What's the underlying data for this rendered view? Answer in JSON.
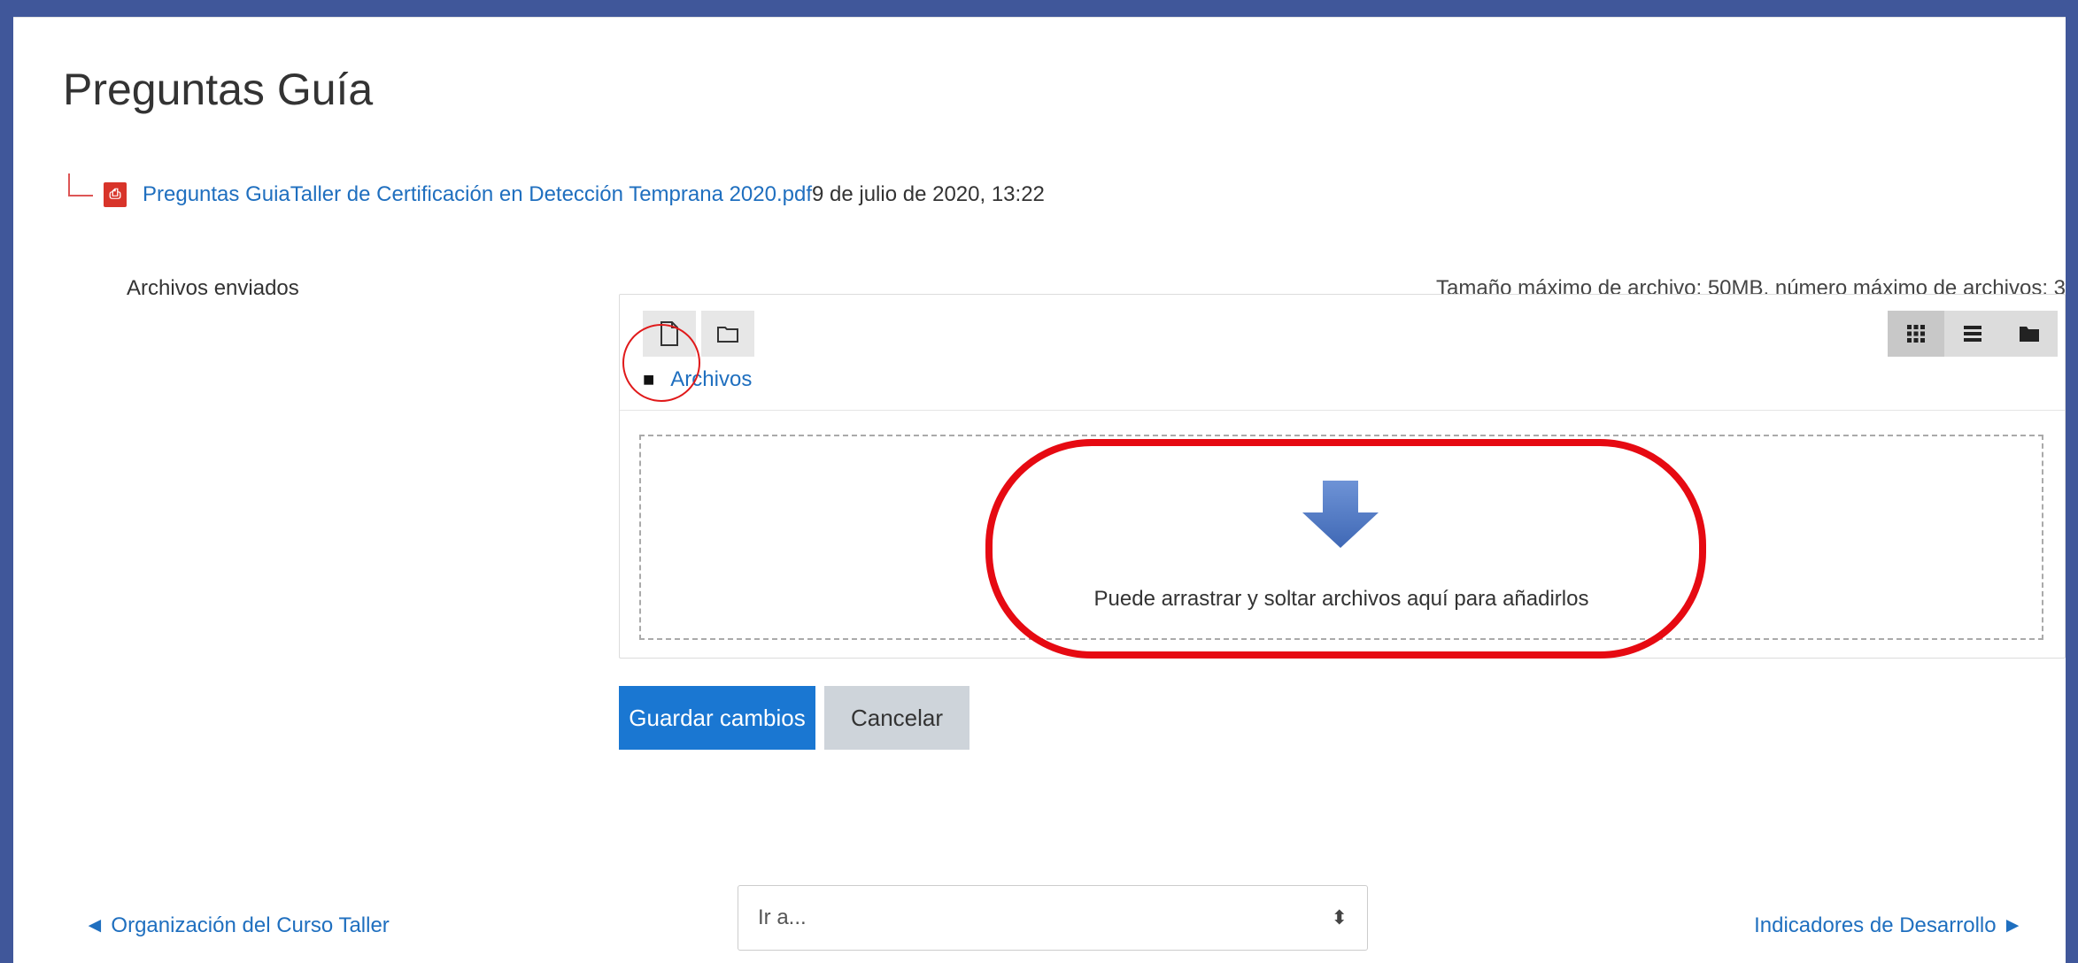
{
  "page": {
    "title": "Preguntas Guía"
  },
  "attachment": {
    "link_text": "Preguntas GuiaTaller de Certificación en Detección Temprana 2020.pdf",
    "date": "9 de julio de 2020, 13:22",
    "icon": "pdf-icon"
  },
  "form": {
    "field_label": "Archivos enviados",
    "limits_text": "Tamaño máximo de archivo: 50MB, número máximo de archivos: 3"
  },
  "filemanager": {
    "toolbar_icons": [
      "add-file-icon",
      "create-folder-icon"
    ],
    "view_icons": [
      "grid-view-icon",
      "list-view-icon",
      "tree-view-icon"
    ],
    "path_label": "Archivos",
    "drop_text": "Puede arrastrar y soltar archivos aquí para añadirlos"
  },
  "buttons": {
    "save": "Guardar cambios",
    "cancel": "Cancelar"
  },
  "navigation": {
    "prev": "◄ Organización del Curso Taller",
    "jump_placeholder": "Ir a...",
    "next": "Indicadores de Desarrollo ►"
  },
  "colors": {
    "frame": "#40579a",
    "link": "#1f6fbf",
    "primary": "#1a77d2",
    "highlight": "#e60a12"
  }
}
